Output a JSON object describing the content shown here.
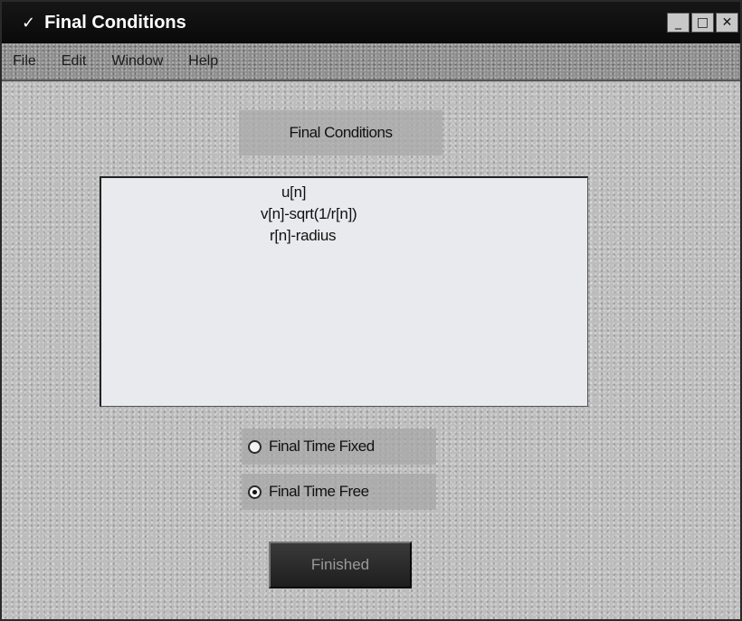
{
  "window": {
    "title": "Final Conditions",
    "title_icon": "checkmark-icon",
    "controls": {
      "minimize": "_",
      "maximize": "□",
      "close": "✕"
    }
  },
  "menu": {
    "items": [
      "File",
      "Edit",
      "Window",
      "Help"
    ]
  },
  "main": {
    "heading": "Final Conditions",
    "conditions": [
      "u[n]",
      "v[n]-sqrt(1/r[n])",
      "r[n]-radius"
    ],
    "radio_options": [
      {
        "label": "Final Time Fixed",
        "checked": false
      },
      {
        "label": "Final Time Free",
        "checked": true
      }
    ],
    "finished_label": "Finished"
  }
}
